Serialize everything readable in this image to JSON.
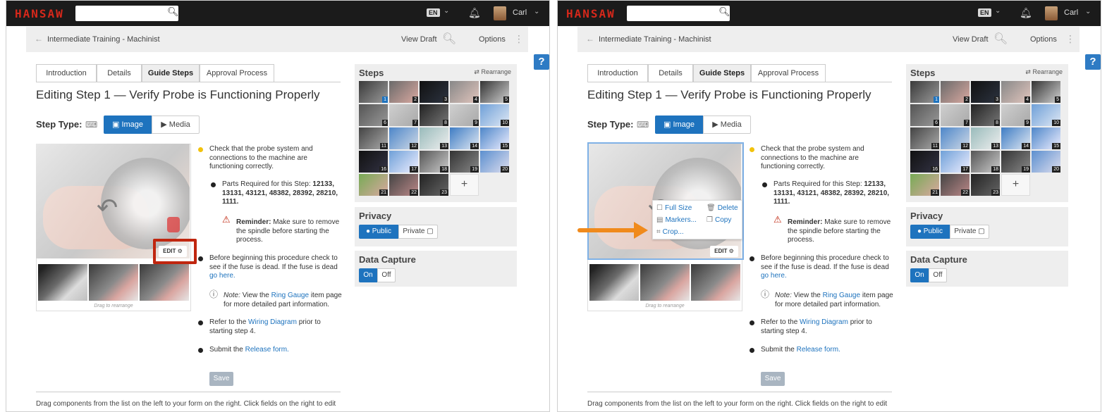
{
  "topbar": {
    "brand": "HANSAW",
    "lang": "EN",
    "user": "Carl"
  },
  "crumbbar": {
    "breadcrumb": "Intermediate Training - Machinist",
    "view_draft": "View Draft",
    "options": "Options"
  },
  "help": "?",
  "tabs": [
    "Introduction",
    "Details",
    "Guide Steps",
    "Approval Process"
  ],
  "active_tab": "Guide Steps",
  "title": "Editing Step 1 — Verify Probe is Functioning Properly",
  "step_type": {
    "label": "Step Type:",
    "image": "Image",
    "media": "Media"
  },
  "photo": {
    "edit": "EDIT",
    "drag_label": "Drag to rearrange"
  },
  "bullets": {
    "b1": "Check that the probe system and connections to the machine are functioning correctly.",
    "b2_prefix": "Parts Required for this Step:",
    "b2_parts": "12133, 13131, 43121, 48382, 28392, 28210, 1111.",
    "reminder_label": "Reminder:",
    "reminder_text": "Make sure to remove the spindle before starting the process.",
    "b3_text": "Before beginning this procedure check to see if the fuse is dead. If the fuse is dead",
    "b3_link": "go here.",
    "note_label": "Note:",
    "note_pre": "View the",
    "note_link": "Ring Gauge",
    "note_post": "item page for more detailed part information.",
    "b4_pre": "Refer to the",
    "b4_link": "Wiring Diagram",
    "b4_post": "prior to starting step 4.",
    "b5_pre": "Submit the",
    "b5_link": "Release form."
  },
  "save": "Save",
  "bottom_text": "Drag components from the list on the left to your form on the right. Click fields on the right to edit",
  "steps": {
    "title": "Steps",
    "rearrange": "Rearrange",
    "numbers": [
      "1",
      "2",
      "3",
      "4",
      "5",
      "6",
      "7",
      "8",
      "9",
      "10",
      "11",
      "12",
      "13",
      "14",
      "15",
      "16",
      "17",
      "18",
      "19",
      "20",
      "21",
      "22",
      "23"
    ],
    "add": "+"
  },
  "privacy": {
    "title": "Privacy",
    "public": "Public",
    "private": "Private"
  },
  "data_capture": {
    "title": "Data Capture",
    "on": "On",
    "off": "Off"
  },
  "context_menu": {
    "full_size": "Full Size",
    "delete": "Delete",
    "markers": "Markers...",
    "copy": "Copy",
    "crop": "Crop..."
  },
  "colors": {
    "brand_red": "#d6281b",
    "accent_blue": "#1e73be",
    "highlight_red": "#c0260f",
    "arrow_orange": "#f08a1c",
    "bullet_yellow": "#f2c20c"
  }
}
